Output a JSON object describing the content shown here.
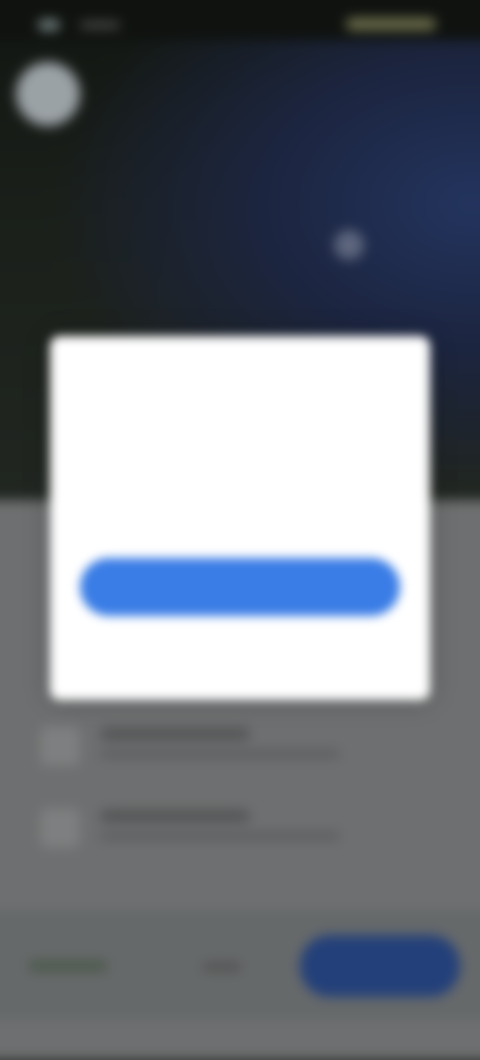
{
  "dialog": {
    "title": "",
    "body": "",
    "primary_button": "",
    "secondary_button": ""
  },
  "colors": {
    "primary": "#3a7de6",
    "dialog_bg": "#ffffff",
    "scrim": "#6d6f70"
  }
}
